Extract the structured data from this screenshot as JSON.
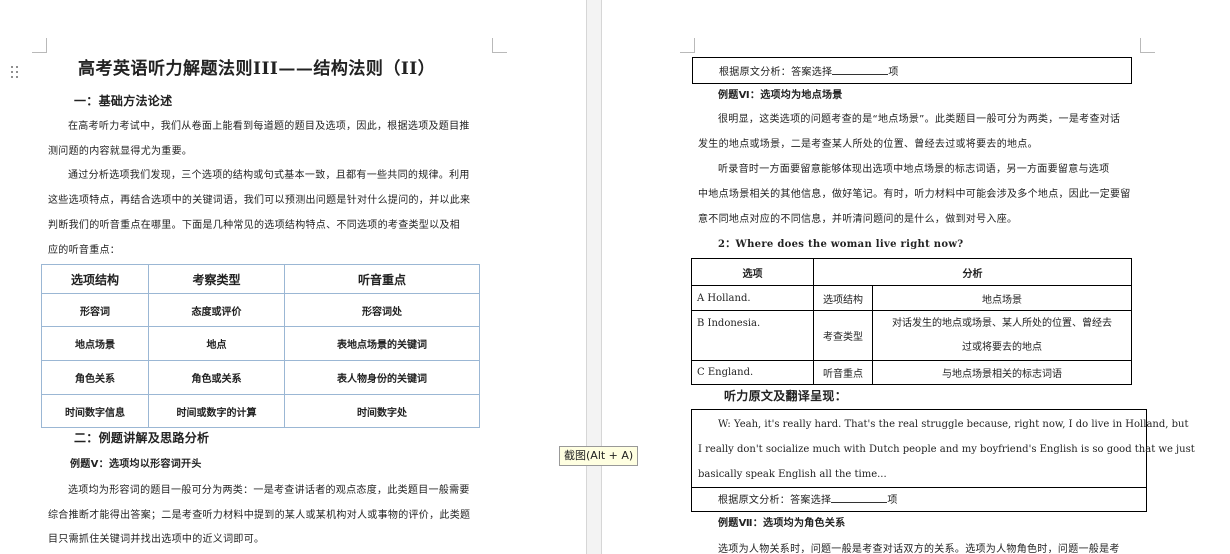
{
  "left": {
    "title": "高考英语听力解题法则III——结构法则（II）",
    "sec1": "一：基础方法论述",
    "para1": [
      "在高考听力考试中，我们从卷面上能看到每道题的题目及选项，因此，根据选项及题目推",
      "测问题的内容就显得尤为重要。"
    ],
    "para2": [
      "通过分析选项我们发现，三个选项的结构或句式基本一致，且都有一些共同的规律。利用",
      "这些选项特点，再结合选项中的关键词语，我们可以预测出问题是针对什么提问的，并以此来",
      "判断我们的听音重点在哪里。下面是几种常见的选项结构特点、不同选项的考查类型以及相",
      "应的听音重点："
    ],
    "table_header": [
      "选项结构",
      "考察类型",
      "听音重点"
    ],
    "table_rows": [
      [
        "形容词",
        "态度或评价",
        "形容词处"
      ],
      [
        "地点场景",
        "地点",
        "表地点场景的关键词"
      ],
      [
        "角色关系",
        "角色或关系",
        "表人物身份的关键词"
      ],
      [
        "时间数字信息",
        "时间或数字的计算",
        "时间数字处"
      ]
    ],
    "sec2": "二：例题讲解及思路分析",
    "ex5_title": "例题Ⅴ：选项均以形容词开头",
    "para3": [
      "选项均为形容词的题目一般可分为两类：一是考查讲话者的观点态度，此类题目一般需要",
      "综合推断才能得出答案；二是考查听力材料中提到的某人或某机构对人或事物的评价，此类题",
      "目只需抓住关键词并找出选项中的近义词即可。"
    ]
  },
  "right": {
    "analysis_top": "根据原文分析：答案选择",
    "analysis_suffix": "项",
    "ex6_title": "例题Ⅵ：选项均为地点场景",
    "para4": [
      "很明显，这类选项的问题考查的是“地点场景”。此类题目一般可分为两类，一是考查对话",
      "发生的地点或场景，二是考查某人所处的位置、曾经去过或将要去的地点。"
    ],
    "para5": [
      "听录音时一方面要留意能够体现出选项中地点场景的标志词语，另一方面要留意与选项",
      "中地点场景相关的其他信息，做好笔记。有时，听力材料中可能会涉及多个地点，因此一定要留",
      "意不同地点对应的不同信息，并听清问题问的是什么，做到对号入座。"
    ],
    "question": "2：Where does the woman live right now?",
    "t2_header": [
      "选项",
      "分析"
    ],
    "t2_options": [
      "A Holland.",
      "B Indonesia.",
      "C England."
    ],
    "t2_labels": [
      "选项结构",
      "考查类型",
      "听音重点"
    ],
    "t2_values": [
      "地点场景",
      [
        "对话发生的地点或场景、某人所处的位置、曾经去",
        "过或将要去的地点"
      ],
      "与地点场景相关的标志词语"
    ],
    "transcript_title": "听力原文及翻译呈现：",
    "transcript": [
      "W: Yeah, it's really hard. That's the real struggle because, right now, I do live in Holland, but",
      "I really don't socialize much with Dutch people and my boyfriend's English is so good that we just",
      "basically speak English all the time..."
    ],
    "analysis_bottom": "根据原文分析：答案选择",
    "ex7_title": "例题Ⅶ：选项均为角色关系",
    "para6": "选项为人物关系时，问题一般是考查对话双方的关系。选项为人物角色时，问题一般是考"
  },
  "tooltip": "截图(Alt + A)"
}
